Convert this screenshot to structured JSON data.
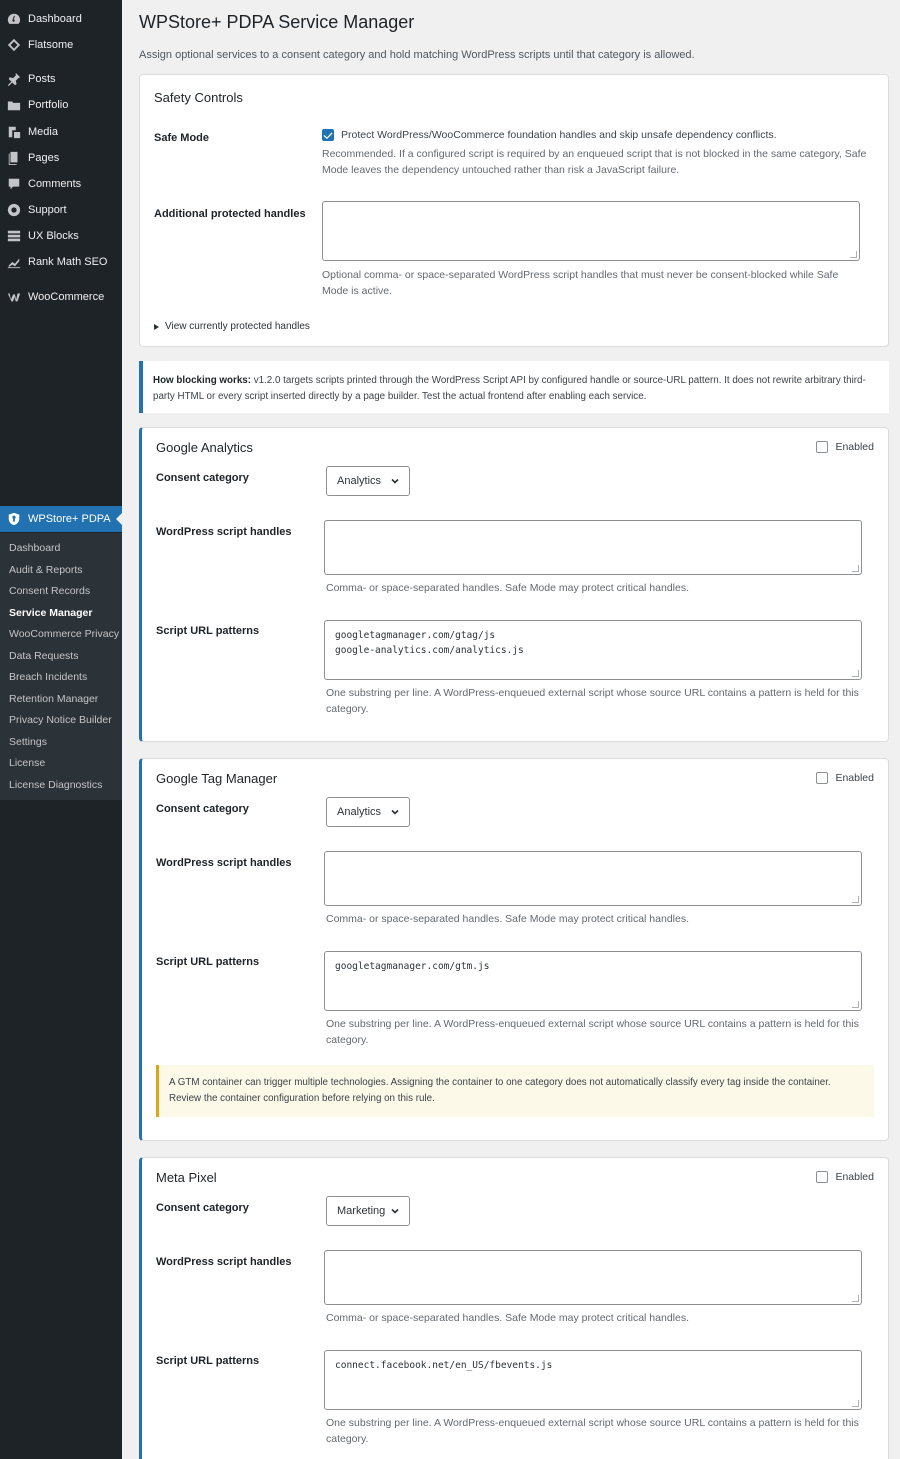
{
  "menu": {
    "top": [
      {
        "label": "Dashboard",
        "icon": "dashboard-icon"
      },
      {
        "label": "Flatsome",
        "icon": "diamond-icon"
      },
      {
        "label": "Posts",
        "icon": "pin-icon"
      },
      {
        "label": "Portfolio",
        "icon": "folder-icon"
      },
      {
        "label": "Media",
        "icon": "media-icon"
      },
      {
        "label": "Pages",
        "icon": "pages-icon"
      },
      {
        "label": "Comments",
        "icon": "comment-icon"
      },
      {
        "label": "Support",
        "icon": "lifebuoy-icon"
      },
      {
        "label": "UX Blocks",
        "icon": "blocks-icon"
      },
      {
        "label": "Rank Math SEO",
        "icon": "chart-icon"
      },
      {
        "label": "WooCommerce",
        "icon": "woo-icon"
      }
    ],
    "current": {
      "label": "WPStore+ PDPA",
      "icon": "shield-icon"
    },
    "submenu": [
      "Dashboard",
      "Audit & Reports",
      "Consent Records",
      "Service Manager",
      "WooCommerce Privacy",
      "Data Requests",
      "Breach Incidents",
      "Retention Manager",
      "Privacy Notice Builder",
      "Settings",
      "License",
      "License Diagnostics"
    ],
    "submenu_active": "Service Manager"
  },
  "page": {
    "title": "WPStore+ PDPA Service Manager",
    "description": "Assign optional services to a consent category and hold matching WordPress scripts until that category is allowed."
  },
  "safety": {
    "title": "Safety Controls",
    "safe_mode_label": "Safe Mode",
    "safe_mode_checked": true,
    "safe_mode_text": "Protect WordPress/WooCommerce foundation handles and skip unsafe dependency conflicts.",
    "safe_mode_desc": "Recommended. If a configured script is required by an enqueued script that is not blocked in the same category, Safe Mode leaves the dependency untouched rather than risk a JavaScript failure.",
    "handles_label": "Additional protected handles",
    "handles_value": "",
    "handles_desc": "Optional comma- or space-separated WordPress script handles that must never be consent-blocked while Safe Mode is active.",
    "details_label": "View currently protected handles"
  },
  "notice": {
    "strong": "How blocking works:",
    "text": " v1.2.0 targets scripts printed through the WordPress Script API by configured handle or source-URL pattern. It does not rewrite arbitrary third-party HTML or every script inserted directly by a page builder. Test the actual frontend after enabling each service."
  },
  "common": {
    "enabled_label": "Enabled",
    "category_label": "Consent category",
    "handles_label": "WordPress script handles",
    "handles_desc": "Comma- or space-separated handles. Safe Mode may protect critical handles.",
    "patterns_label": "Script URL patterns",
    "patterns_desc": "One substring per line. A WordPress-enqueued external script whose source URL contains a pattern is held for this category."
  },
  "services": [
    {
      "name": "Google Analytics",
      "enabled": false,
      "category": "Analytics",
      "handles": "",
      "patterns": "googletagmanager.com/gtag/js\ngoogle-analytics.com/analytics.js"
    },
    {
      "name": "Google Tag Manager",
      "enabled": false,
      "category": "Analytics",
      "handles": "",
      "patterns": "googletagmanager.com/gtm.js",
      "warning": "A GTM container can trigger multiple technologies. Assigning the container to one category does not automatically classify every tag inside the container. Review the container configuration before relying on this rule."
    },
    {
      "name": "Meta Pixel",
      "enabled": false,
      "category": "Marketing",
      "handles": "",
      "patterns": "connect.facebook.net/en_US/fbevents.js"
    }
  ],
  "colors": {
    "sidebar": "#1d2327",
    "submenu": "#2c3338",
    "accent": "#2271b1",
    "warning": "#dba617"
  }
}
